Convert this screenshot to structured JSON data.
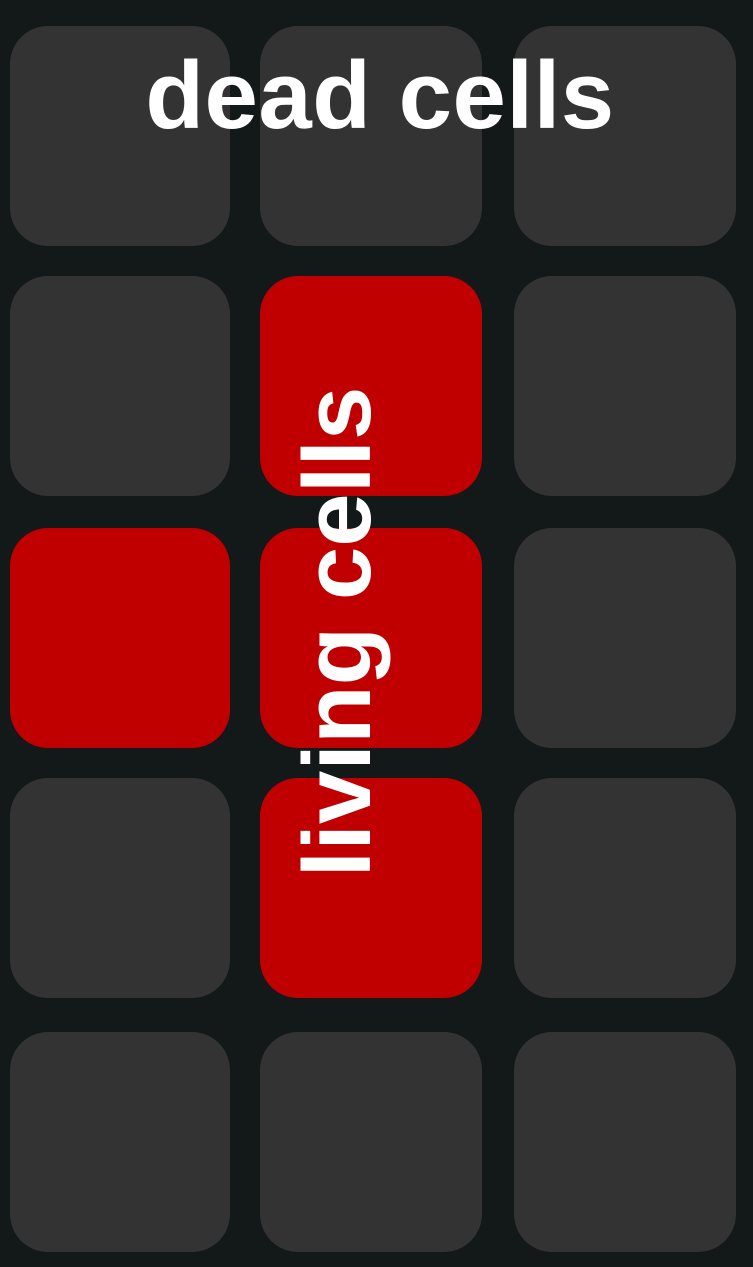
{
  "grid": {
    "rows": 5,
    "cols": 3,
    "cells": [
      [
        0,
        0,
        0
      ],
      [
        0,
        1,
        0
      ],
      [
        1,
        1,
        0
      ],
      [
        0,
        1,
        0
      ],
      [
        0,
        0,
        0
      ]
    ]
  },
  "colors": {
    "background": "#131819",
    "dead_cell": "#333333",
    "living_cell": "#c00000",
    "label_text": "#ffffff"
  },
  "labels": {
    "dead": "dead cells",
    "living": "living cells"
  }
}
